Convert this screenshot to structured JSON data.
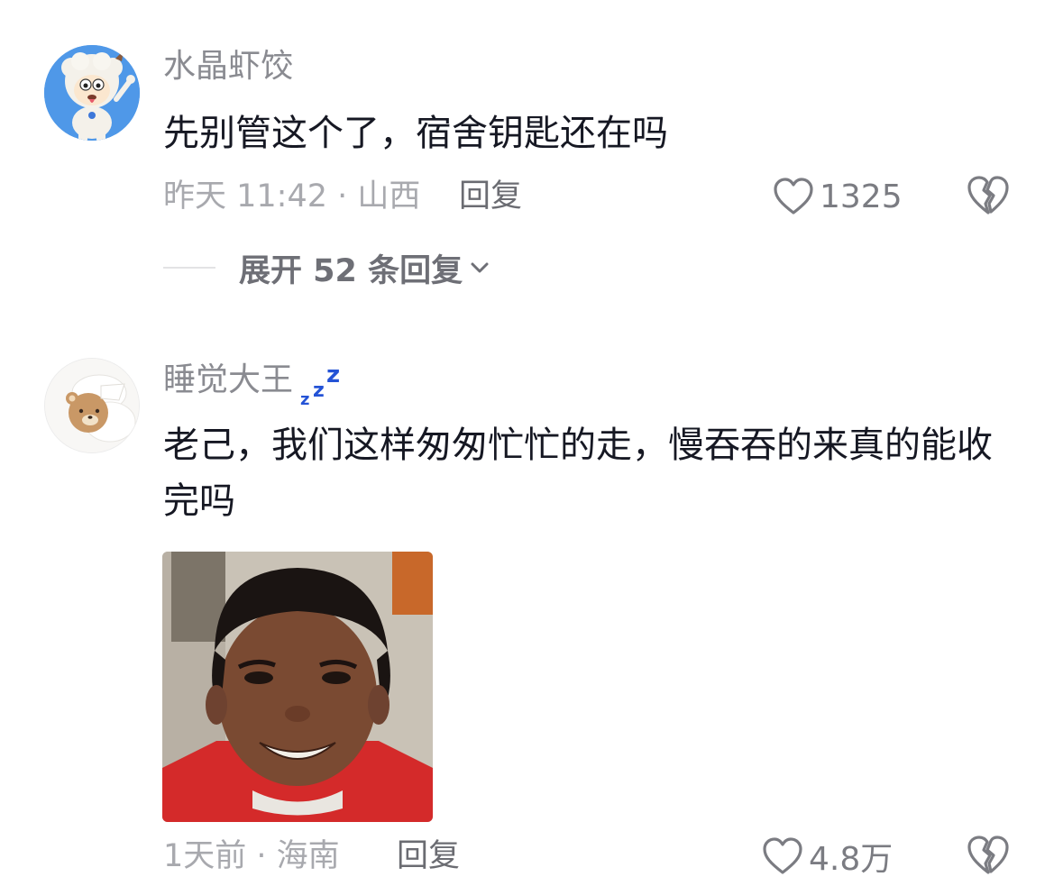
{
  "comments": [
    {
      "username": "水晶虾饺",
      "text": "先别管这个了，宿舍钥匙还在吗",
      "time_location": "昨天 11:42 · 山西",
      "reply_label": "回复",
      "likes": "1325",
      "expand_label": "展开 52 条回复"
    },
    {
      "username": "睡觉大王",
      "username_emoji": "zzz",
      "text": "老己，我们这样匆匆忙忙的走，慢吞吞的来真的能收完吗",
      "time_location": "1天前 · 海南",
      "reply_label": "回复",
      "likes": "4.8万"
    }
  ],
  "icons": {
    "like": "heart-outline-icon",
    "dislike": "broken-heart-icon",
    "expand": "chevron-down-icon"
  },
  "colors": {
    "username": "#8a8b91",
    "text": "#161823",
    "meta": "#a8a9ae",
    "zzz_emoji": "#2453d6",
    "photo_shirt": "#d42a2a"
  }
}
